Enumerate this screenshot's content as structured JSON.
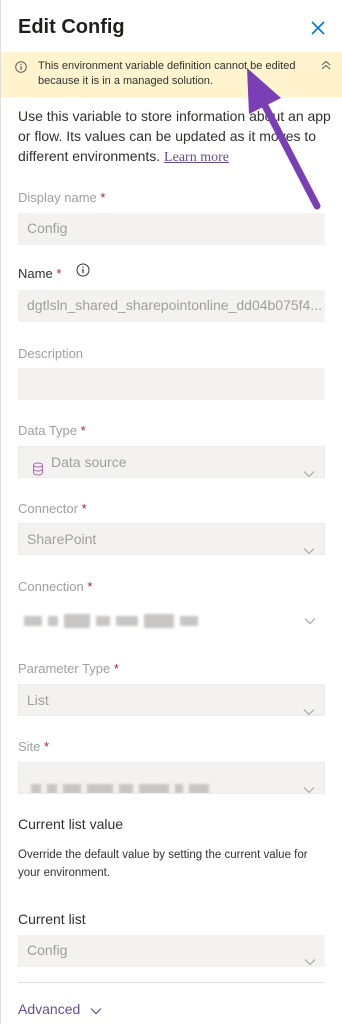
{
  "header": {
    "title": "Edit Config",
    "close_icon": "close-icon"
  },
  "warning": {
    "message": "This environment variable definition cannot be edited because it is in a managed solution.",
    "icon": "info-icon",
    "collapse_icon": "chevron-double-up-icon"
  },
  "description": {
    "text": "Use this variable to store information about an app or flow. Its values can be updated as it moves to different environments.",
    "link": "Learn more"
  },
  "fields": {
    "display_name": {
      "label": "Display name",
      "required": "*",
      "value": "Config"
    },
    "name": {
      "label": "Name",
      "required": "*",
      "value": "dgtlsln_shared_sharepointonline_dd04b075f4..."
    },
    "description": {
      "label": "Description",
      "value": ""
    },
    "data_type": {
      "label": "Data Type",
      "required": "*",
      "value": "Data source",
      "icon": "database-icon"
    },
    "connector": {
      "label": "Connector",
      "required": "*",
      "value": "SharePoint"
    },
    "connection": {
      "label": "Connection",
      "required": "*"
    },
    "parameter_type": {
      "label": "Parameter Type",
      "required": "*",
      "value": "List"
    },
    "site": {
      "label": "Site",
      "required": "*"
    }
  },
  "current_list_section": {
    "heading": "Current list value",
    "help": "Override the default value by setting the current value for your environment.",
    "label": "Current list",
    "value": "Config"
  },
  "advanced": {
    "label": "Advanced"
  },
  "colors": {
    "accent": "#6a4c93",
    "warning_bg": "#fff4ce",
    "required": "#a4262c",
    "annotation_arrow": "#7b3fb5"
  }
}
